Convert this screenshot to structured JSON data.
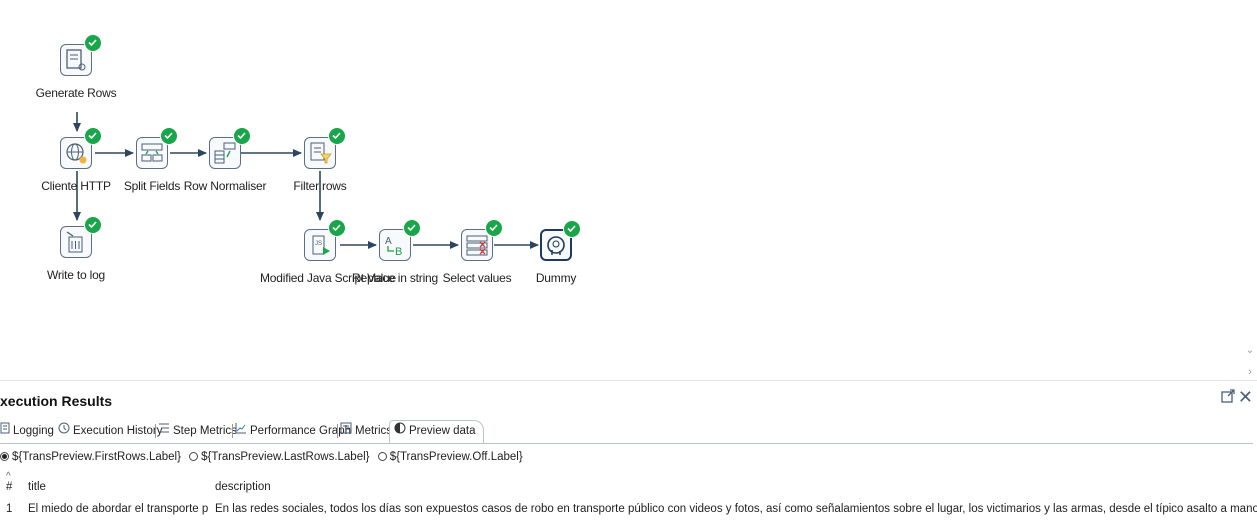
{
  "canvas": {
    "steps": [
      {
        "id": "generate-rows",
        "label": "Generate Rows",
        "icon": "generate-rows-icon"
      },
      {
        "id": "cliente-http",
        "label": "Cliente HTTP",
        "icon": "http-client-icon"
      },
      {
        "id": "split-fields",
        "label": "Split Fields",
        "icon": "split-fields-icon"
      },
      {
        "id": "row-normaliser",
        "label": "Row Normaliser",
        "icon": "row-normaliser-icon"
      },
      {
        "id": "filter-rows",
        "label": "Filter rows",
        "icon": "filter-rows-icon"
      },
      {
        "id": "write-to-log",
        "label": "Write to log",
        "icon": "write-to-log-icon"
      },
      {
        "id": "modified-js",
        "label": "Modified Java Script Value",
        "icon": "javascript-icon"
      },
      {
        "id": "replace-string",
        "label": "Replace in string",
        "icon": "replace-string-icon"
      },
      {
        "id": "select-values",
        "label": "Select values",
        "icon": "select-values-icon"
      },
      {
        "id": "dummy",
        "label": "Dummy",
        "icon": "dummy-icon"
      }
    ],
    "status_icon": "success-check-icon",
    "accent": "#19a54a"
  },
  "results": {
    "title": "xecution Results",
    "restore_icon": "restore-window-icon",
    "close_icon": "close-icon",
    "tabs": [
      {
        "label": "Logging",
        "icon": "logging-icon"
      },
      {
        "label": "Execution History",
        "icon": "history-icon"
      },
      {
        "label": "Step Metrics",
        "icon": "step-metrics-icon"
      },
      {
        "label": "Performance Graph",
        "icon": "graph-icon"
      },
      {
        "label": "Metrics",
        "icon": "metrics-icon"
      },
      {
        "label": "Preview data",
        "icon": "preview-icon",
        "active": true
      }
    ],
    "preview_options": [
      {
        "label": "${TransPreview.FirstRows.Label}",
        "selected": true
      },
      {
        "label": "${TransPreview.LastRows.Label}",
        "selected": false
      },
      {
        "label": "${TransPreview.Off.Label}",
        "selected": false
      }
    ],
    "table": {
      "sort_indicator": "^",
      "columns": [
        "#",
        "title",
        "description"
      ],
      "rows": [
        [
          "1",
          "El miedo de abordar el transporte públi...",
          "En las redes sociales, todos los días son expuestos casos de robo en transporte público con videos y fotos, así como señalamientos sobre el lugar, los victimarios y las armas, desde el típico asalto a mano armada de un camión hasta casos mediát"
        ]
      ]
    }
  }
}
